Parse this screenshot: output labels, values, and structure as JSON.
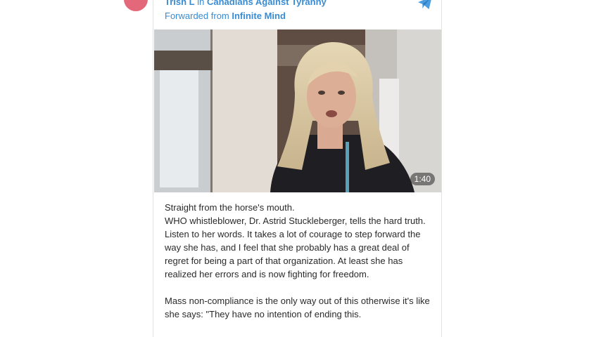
{
  "post": {
    "author": "Trish L",
    "in_word": "in",
    "channel": "Canadians Against Tyranny",
    "forwarded_prefix": "Forwarded from",
    "forwarded_source": "Infinite Mind"
  },
  "video": {
    "duration": "1:40"
  },
  "message": {
    "line1": "Straight from the horse's mouth.",
    "paragraph1": "WHO whistleblower, Dr. Astrid Stuckleberger, tells the hard truth. Listen to her words. It takes a lot of courage to step forward the way she has, and I feel that she probably has a great deal of regret for being a part of that organization. At least she has realized her errors and is now fighting for freedom.",
    "paragraph2": "Mass non-compliance is the only way out of this otherwise it's like she says: \"They have no intention of ending this."
  },
  "colors": {
    "link": "#3a8bd1",
    "avatar": "#e2687a",
    "text": "#2a2a2a"
  },
  "icons": {
    "share": "telegram-plane-icon",
    "avatar": "avatar"
  }
}
